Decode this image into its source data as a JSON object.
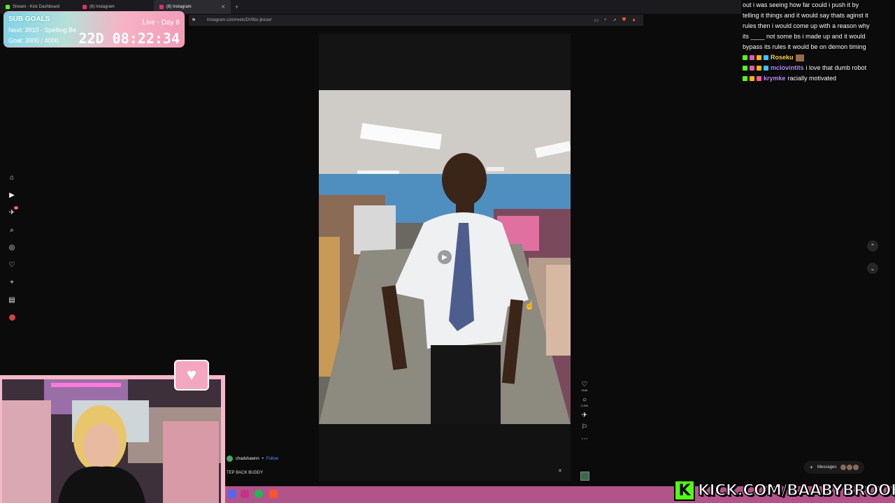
{
  "browser": {
    "tabs": [
      {
        "label": "Stream - Kick Dashboard",
        "color": "#53fc18",
        "active": false
      },
      {
        "label": "(8) Instagram",
        "color": "#e1306c",
        "active": false
      },
      {
        "label": "(8) Instagram",
        "color": "#e1306c",
        "active": true
      }
    ],
    "url": "instagram.com/reels/DV9bc-jkosw/"
  },
  "subgoals": {
    "title": "SUB GOALS",
    "next": "Next: 3910 - Spelling Be",
    "goal": "Goal: 3900 / 4000",
    "live": "Live - Day 8",
    "timer": "22D 08:22:34"
  },
  "ig_nav": {
    "items": [
      "home-icon",
      "reels-icon",
      "messages-icon",
      "search-icon",
      "explore-icon",
      "notifications-icon",
      "create-icon",
      "dashboard-icon",
      "profile-icon"
    ],
    "badge": "99"
  },
  "reel": {
    "author": "chadshawnn",
    "follow": "Follow",
    "caption": "TEP BACK BUDDY",
    "likes": "154K",
    "comments": "2,949"
  },
  "chat": {
    "lines": [
      "out i was seeing how far could i push it by",
      "telling it things and it would say thats aginst it",
      "rules then i would come up with a reason why",
      "its ____ not some bs i made up and it would",
      "bypass its rules it would be on demon timing"
    ],
    "messages": [
      {
        "name": "Roseku",
        "text": "",
        "color": "#ffd84a"
      },
      {
        "name": "mclovintits",
        "text": "i love that dumb robot",
        "color": "#b98bff"
      },
      {
        "name": "krymke",
        "text": "racially motivated",
        "color": "#b98bff"
      }
    ]
  },
  "messages_pill": {
    "label": "Messages"
  },
  "kick_banner": {
    "logo": "K",
    "text": "KICK.COM/BAABYBROOK"
  }
}
